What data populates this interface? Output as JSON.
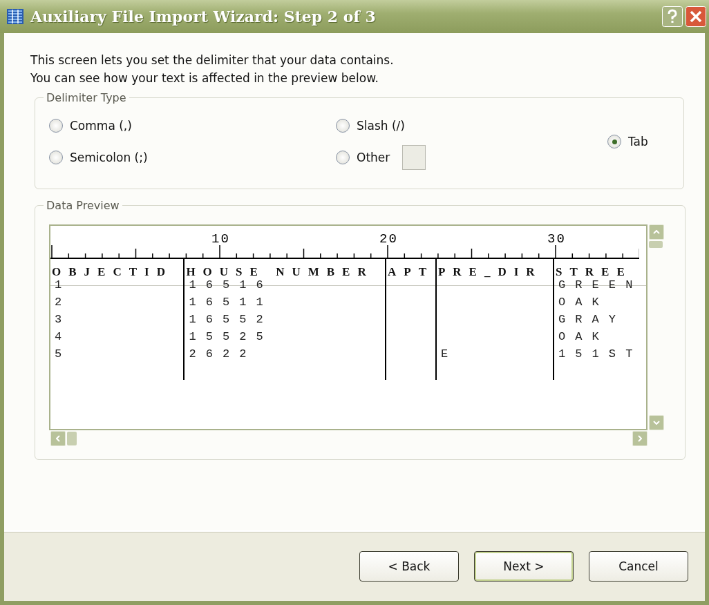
{
  "window": {
    "title": "Auxiliary File Import Wizard: Step 2 of 3"
  },
  "intro": [
    "This screen lets you set the delimiter that your data contains.",
    "You can see how your text is affected in the preview below."
  ],
  "delimiter_type": {
    "title": "Delimiter Type",
    "options": [
      {
        "label": "Comma (,)",
        "selected": false,
        "kind": "plain"
      },
      {
        "label": "Semicolon (;)",
        "selected": false,
        "kind": "plain"
      },
      {
        "label": "Slash (/)",
        "selected": false,
        "kind": "plain"
      },
      {
        "label": "Other",
        "selected": false,
        "kind": "other"
      },
      {
        "label": "Tab",
        "selected": true,
        "kind": "plain"
      }
    ]
  },
  "data_preview": {
    "title": "Data Preview",
    "ruler": [
      "10",
      "20",
      "30"
    ],
    "columns": [
      "OBJECTID",
      "HOUSE NUMBER",
      "APT",
      "PRE_DIR",
      "STREE"
    ],
    "rows": [
      [
        "1",
        "16516",
        "",
        "",
        "GREEN"
      ],
      [
        "2",
        "16511",
        "",
        "",
        "OAK"
      ],
      [
        "3",
        "16552",
        "",
        "",
        "GRAY"
      ],
      [
        "4",
        "15525",
        "",
        "",
        "OAK"
      ],
      [
        "5",
        "2622",
        "",
        "E",
        "151ST"
      ]
    ]
  },
  "buttons": [
    "< Back",
    "Next >",
    "Cancel"
  ]
}
